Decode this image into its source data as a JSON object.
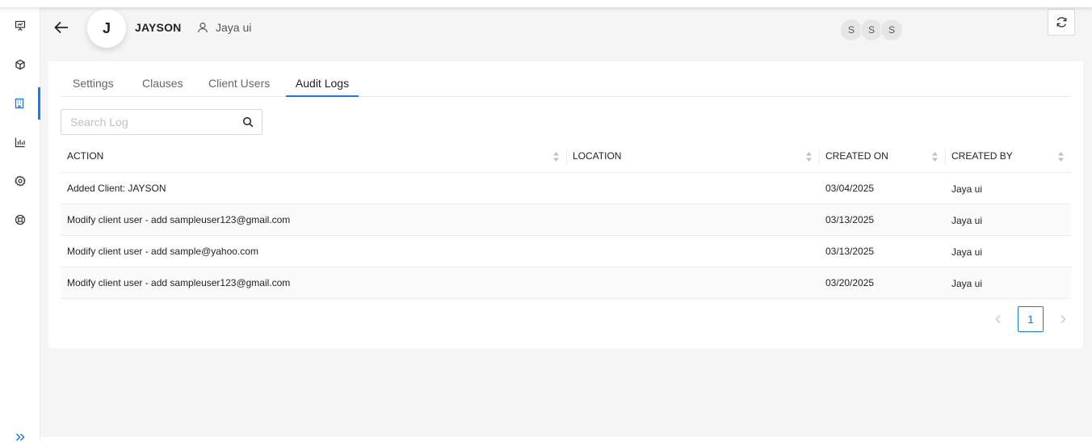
{
  "sidebar": {
    "items": [
      {
        "icon": "presentation-icon",
        "name": "sidebar-item-dashboard"
      },
      {
        "icon": "cube-icon",
        "name": "sidebar-item-products"
      },
      {
        "icon": "building-icon",
        "name": "sidebar-item-clients",
        "active": true
      },
      {
        "icon": "bar-chart-icon",
        "name": "sidebar-item-reports"
      },
      {
        "icon": "gear-icon",
        "name": "sidebar-item-settings"
      },
      {
        "icon": "lifebuoy-icon",
        "name": "sidebar-item-support"
      }
    ],
    "expand_icon": "double-chevron-right-icon"
  },
  "header": {
    "avatar_letter": "J",
    "client_name": "JAYSON",
    "user_name": "Jaya ui",
    "presence": [
      "S",
      "S",
      "S"
    ]
  },
  "tabs": [
    {
      "label": "Settings",
      "active": false
    },
    {
      "label": "Clauses",
      "active": false
    },
    {
      "label": "Client Users",
      "active": false
    },
    {
      "label": "Audit Logs",
      "active": true
    }
  ],
  "search": {
    "placeholder": "Search Log",
    "value": ""
  },
  "table": {
    "columns": [
      "ACTION",
      "LOCATION",
      "CREATED ON",
      "CREATED BY"
    ],
    "rows": [
      {
        "action": "Added Client: JAYSON",
        "location": "",
        "created_on": "03/04/2025",
        "created_by": "Jaya ui"
      },
      {
        "action": "Modify client user - add sampleuser123@gmail.com",
        "location": "",
        "created_on": "03/13/2025",
        "created_by": "Jaya ui"
      },
      {
        "action": "Modify client user - add sample@yahoo.com",
        "location": "",
        "created_on": "03/13/2025",
        "created_by": "Jaya ui"
      },
      {
        "action": "Modify client user - add sampleuser123@gmail.com",
        "location": "",
        "created_on": "03/20/2025",
        "created_by": "Jaya ui"
      }
    ]
  },
  "pagination": {
    "current_page": "1"
  },
  "colors": {
    "accent": "#1677ff",
    "background": "#f5f5f5"
  }
}
